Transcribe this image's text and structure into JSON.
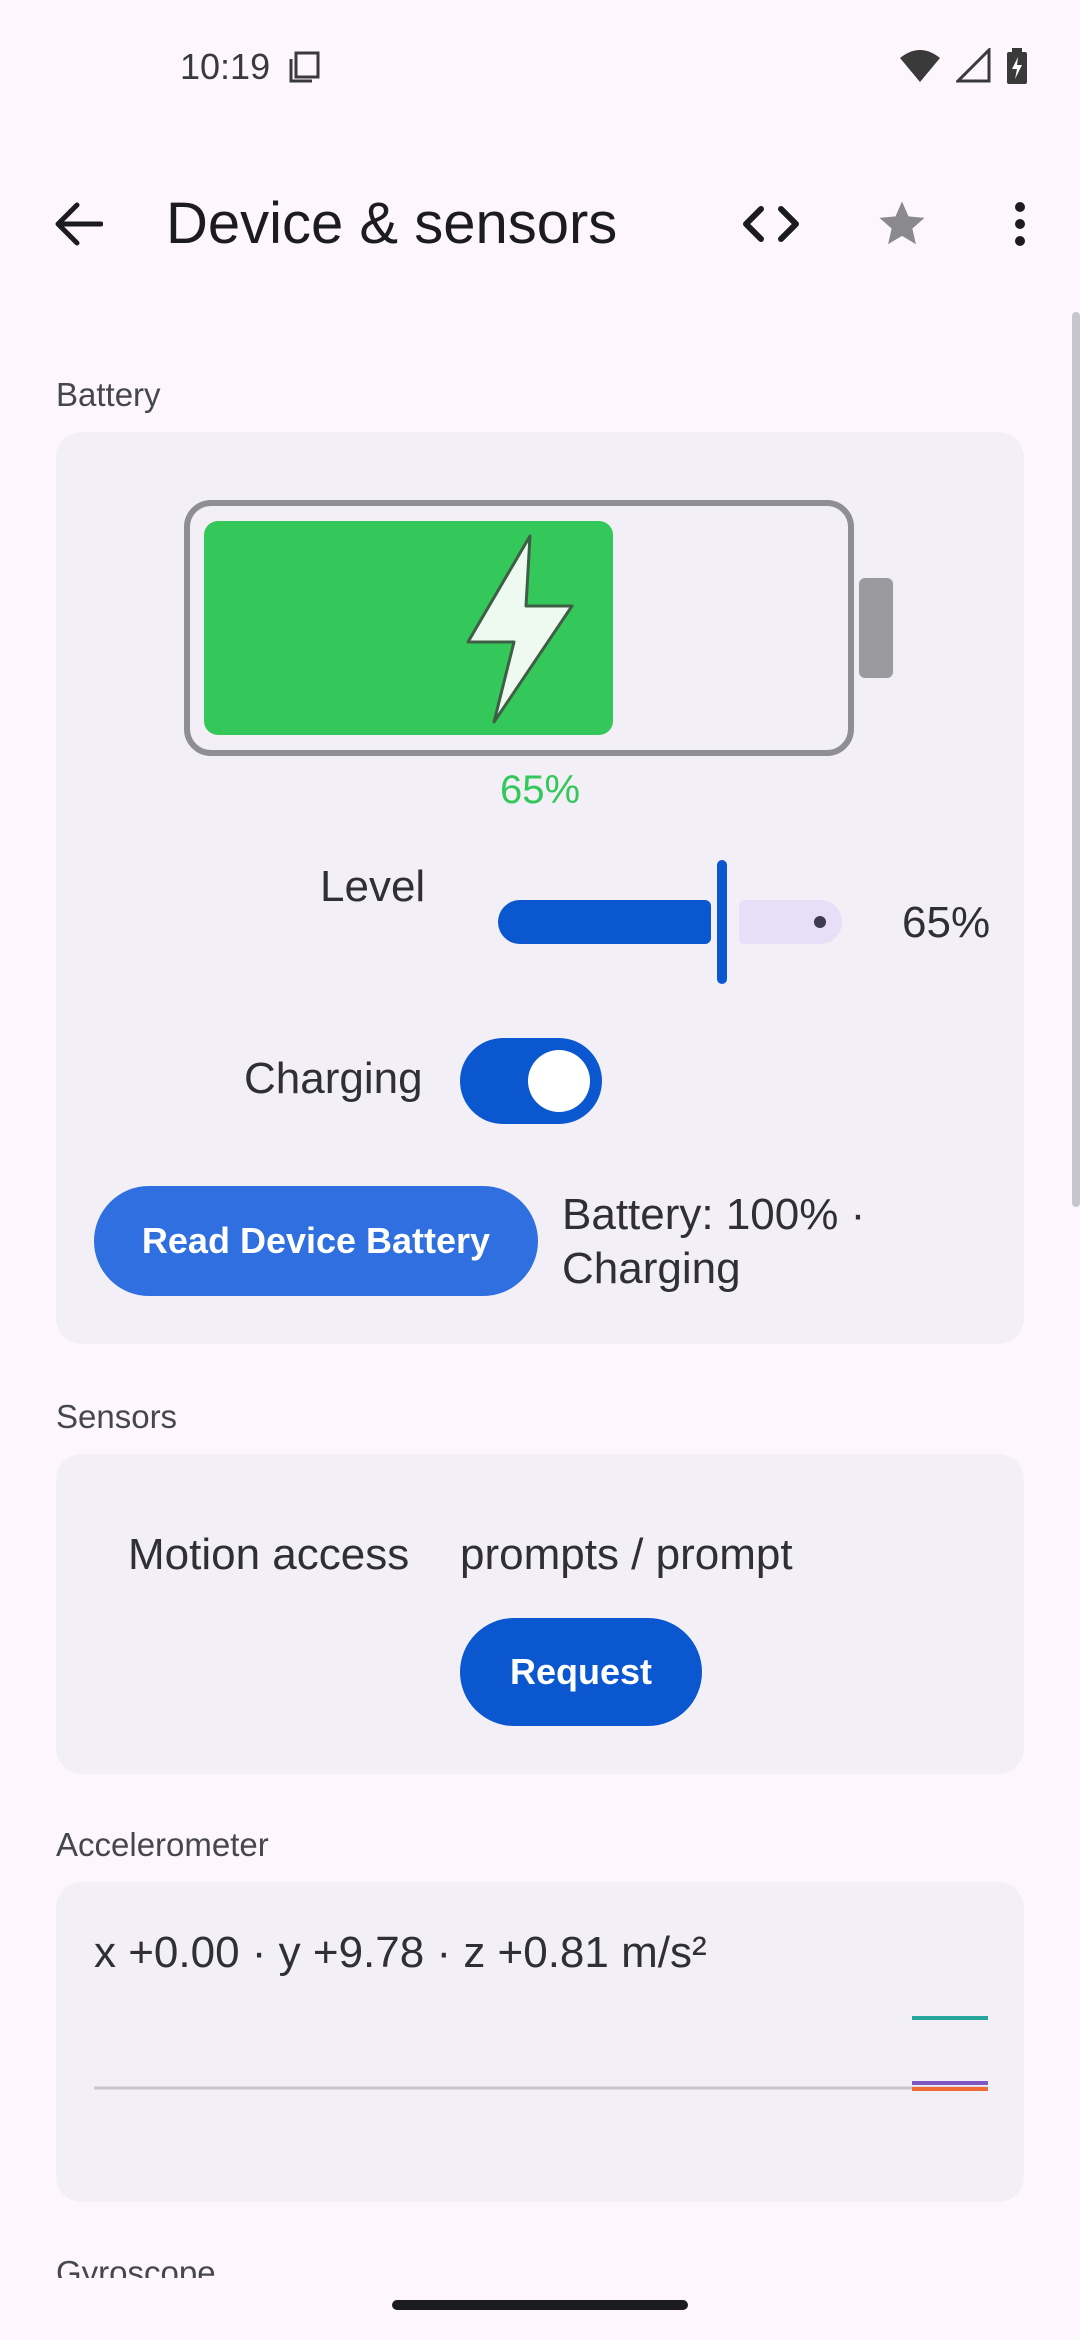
{
  "status_bar": {
    "time": "10:19"
  },
  "app_bar": {
    "title": "Device & sensors"
  },
  "battery_section": {
    "label": "Battery",
    "graphic_percent": "65%",
    "level_fraction": 0.65,
    "level_label": "Level",
    "level_value": "65%",
    "charging_label": "Charging",
    "charging_on": true,
    "read_button": "Read Device Battery",
    "status_text": "Battery: 100% · Charging"
  },
  "sensors_section": {
    "label": "Sensors",
    "motion_label": "Motion access",
    "motion_value": "prompts / prompt",
    "request_button": "Request"
  },
  "accelerometer_section": {
    "label": "Accelerometer",
    "reading": "x +0.00 · y +9.78 · z +0.81 m/s²",
    "colors": {
      "x": "#7e57c2",
      "y": "#26a69a",
      "z": "#ef6c3a"
    }
  },
  "gyroscope_section": {
    "label": "Gyroscope"
  },
  "colors": {
    "accent": "#0b57d0",
    "battery_green": "#34c759",
    "background": "#fdf7fd"
  }
}
